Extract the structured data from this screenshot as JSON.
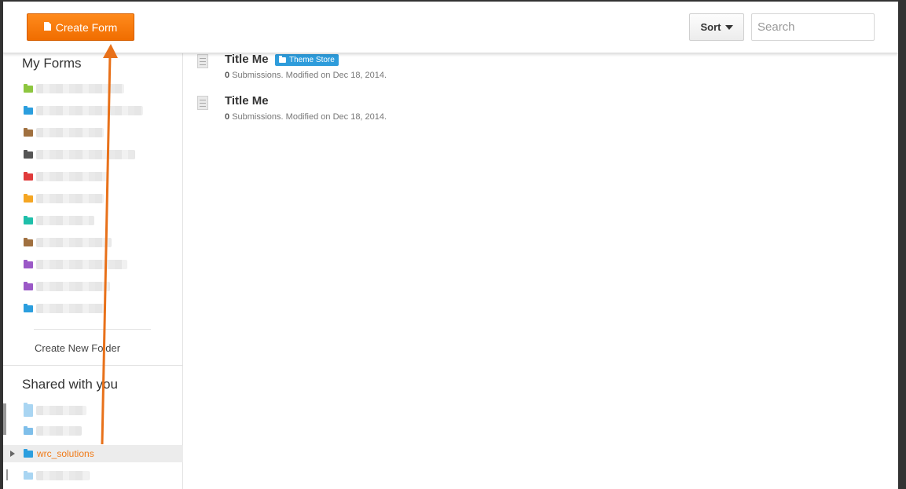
{
  "toolbar": {
    "create_label": "Create Form",
    "sort_label": "Sort",
    "search_placeholder": "Search"
  },
  "sidebar": {
    "my_forms_heading": "My Forms",
    "folders": [
      {
        "color": "#8dc63f",
        "redacted": true
      },
      {
        "color": "#2b9ede",
        "redacted": true
      },
      {
        "color": "#a0703f",
        "redacted": true
      },
      {
        "color": "#555555",
        "redacted": true
      },
      {
        "color": "#e03b3b",
        "redacted": true
      },
      {
        "color": "#f5a623",
        "redacted": true
      },
      {
        "color": "#1fbfaa",
        "redacted": true
      },
      {
        "color": "#a0703f",
        "redacted": true
      },
      {
        "color": "#9b59c7",
        "redacted": true
      },
      {
        "color": "#9b59c7",
        "redacted": true
      },
      {
        "color": "#2b9ede",
        "redacted": true
      }
    ],
    "create_folder_label": "Create New Folder",
    "shared_heading": "Shared with you",
    "shared_items": [
      {
        "label": "",
        "redacted": true
      },
      {
        "label": "",
        "redacted": true
      },
      {
        "label": "wrc_solutions",
        "active": true
      },
      {
        "label": "",
        "redacted": true
      }
    ]
  },
  "forms": [
    {
      "title": "Title Me",
      "tag": "Theme Store",
      "submissions": "0",
      "meta": "Submissions. Modified on Dec 18, 2014."
    },
    {
      "title": "Title Me",
      "submissions": "0",
      "meta": "Submissions. Modified on Dec 18, 2014."
    }
  ],
  "colors": {
    "accent_orange": "#f27700",
    "tag_blue": "#2e9cdb",
    "annotation_arrow": "#e8711a"
  }
}
